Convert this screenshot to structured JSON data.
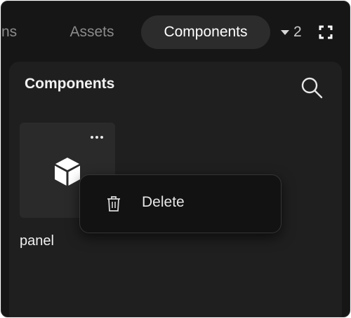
{
  "tabs": {
    "partial_label": "ns",
    "assets_label": "Assets",
    "components_label": "Components",
    "hidden_count": "2"
  },
  "icons": {
    "overflow": "chevron-down-icon",
    "expand": "expand-icon",
    "search": "search-icon",
    "more": "more-horizontal-icon",
    "component": "cube-icon",
    "delete": "trash-icon"
  },
  "panel": {
    "title": "Components",
    "items": [
      {
        "label": "panel"
      }
    ]
  },
  "context_menu": {
    "items": [
      {
        "label": "Delete"
      }
    ]
  },
  "colors": {
    "background": "#161616",
    "panel": "#1f1f1f",
    "active_tab": "#2c2c2c",
    "menu": "#121212"
  }
}
